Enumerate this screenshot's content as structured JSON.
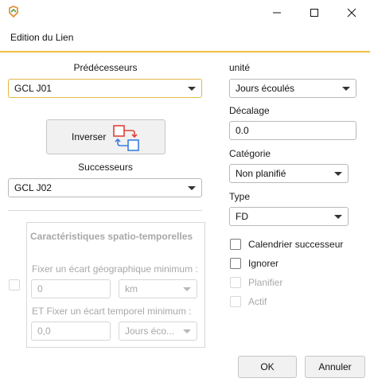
{
  "window": {
    "minimize_icon": "minimize-icon",
    "maximize_icon": "maximize-icon",
    "close_icon": "close-icon"
  },
  "tab": {
    "label": "Edition du Lien"
  },
  "left": {
    "predecessors_label": "Prédécesseurs",
    "predecessors_value": "GCL J01",
    "invert_label": "Inverser",
    "successors_label": "Successeurs",
    "successors_value": "GCL J02"
  },
  "spatio": {
    "title": "Caractéristiques spatio-temporelles",
    "geo_label": "Fixer un écart géographique minimum :",
    "geo_value": "0",
    "geo_unit": "km",
    "time_label": "ET Fixer un écart temporel minimum :",
    "time_value": "0,0",
    "time_unit": "Jours éco..."
  },
  "right": {
    "unit_label": "unité",
    "unit_value": "Jours écoulés",
    "offset_label": "Décalage",
    "offset_value": "0.0",
    "category_label": "Catégorie",
    "category_value": "Non planifié",
    "type_label": "Type",
    "type_value": "FD",
    "cal_successor_label": "Calendrier successeur",
    "ignore_label": "Ignorer",
    "plan_label": "Planifier",
    "active_label": "Actif"
  },
  "footer": {
    "ok_label": "OK",
    "cancel_label": "Annuler"
  },
  "colors": {
    "accent": "#f0c040",
    "focus_border": "#e2b84a",
    "swap_red": "#e0413a",
    "swap_blue": "#3a7fe0"
  }
}
